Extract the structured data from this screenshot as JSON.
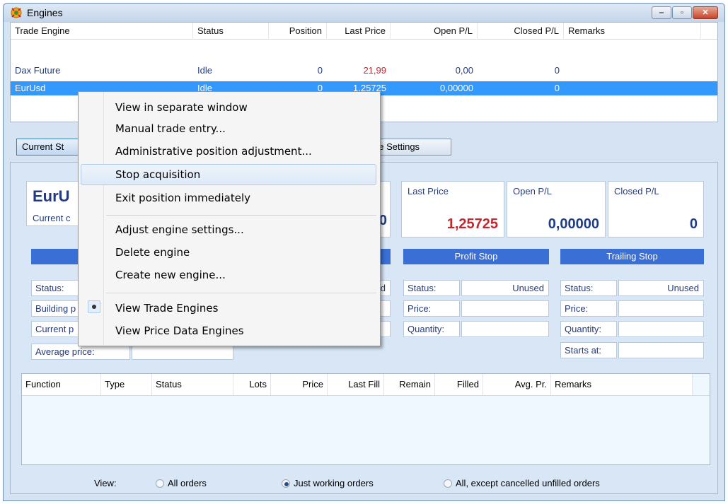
{
  "window": {
    "title": "Engines",
    "icon": "engine-gear-icon",
    "controls": {
      "minimize": "‒",
      "maximize": "▫",
      "close": "✕"
    }
  },
  "engines_grid": {
    "headers": [
      "Trade Engine",
      "Status",
      "Position",
      "Last Price",
      "Open P/L",
      "Closed P/L",
      "Remarks"
    ],
    "rows": [
      {
        "name": "Dax Future",
        "status": "Idle",
        "position": "0",
        "last_price": "21,99",
        "open_pl": "0,00",
        "closed_pl": "0",
        "remarks": ""
      },
      {
        "name": "EurUsd",
        "status": "Idle",
        "position": "0",
        "last_price": "1,25725",
        "open_pl": "0,00000",
        "closed_pl": "0",
        "remarks": ""
      }
    ]
  },
  "tabs": {
    "current_state": "Current St",
    "engine_settings": "ne Settings"
  },
  "summary": {
    "engine_name": "EurU",
    "current_label": "Current c",
    "position_value_partial": "0",
    "last_price_label": "Last Price",
    "last_price_value": "1,25725",
    "open_pl_label": "Open P/L",
    "open_pl_value": "0,00000",
    "closed_pl_label": "Closed P/L",
    "closed_pl_value": "0"
  },
  "entry": {
    "status_label": "Status:",
    "status_value_partial": "d",
    "building_label": "Building p",
    "current_price_label": "Current p",
    "average_price_label": "Average price:"
  },
  "profit_stop": {
    "title": "Profit Stop",
    "status_label": "Status:",
    "status_value": "Unused",
    "price_label": "Price:",
    "quantity_label": "Quantity:"
  },
  "trailing_stop": {
    "title": "Trailing Stop",
    "status_label": "Status:",
    "status_value": "Unused",
    "price_label": "Price:",
    "quantity_label": "Quantity:",
    "starts_label": "Starts at:"
  },
  "orders_grid": {
    "headers": [
      "Function",
      "Type",
      "Status",
      "Lots",
      "Price",
      "Last Fill",
      "Remain",
      "Filled",
      "Avg. Pr.",
      "Remarks"
    ]
  },
  "view_filter": {
    "label": "View:",
    "options": [
      "All orders",
      "Just working orders",
      "All, except cancelled unfilled orders"
    ],
    "selected": "Just working orders"
  },
  "context_menu": {
    "items": [
      "View in separate window",
      "Manual trade entry...",
      "Administrative position adjustment...",
      "Stop acquisition",
      "Exit position immediately",
      "Adjust engine settings...",
      "Delete engine",
      "Create new engine...",
      "View Trade Engines",
      "View Price Data Engines"
    ],
    "highlighted": "Stop acquisition",
    "checked": "View Trade Engines"
  },
  "colors": {
    "selection": "#3399ff",
    "accent_bar": "#3a6fd6",
    "price_red": "#c0282f",
    "value_blue": "#1f3c88"
  }
}
